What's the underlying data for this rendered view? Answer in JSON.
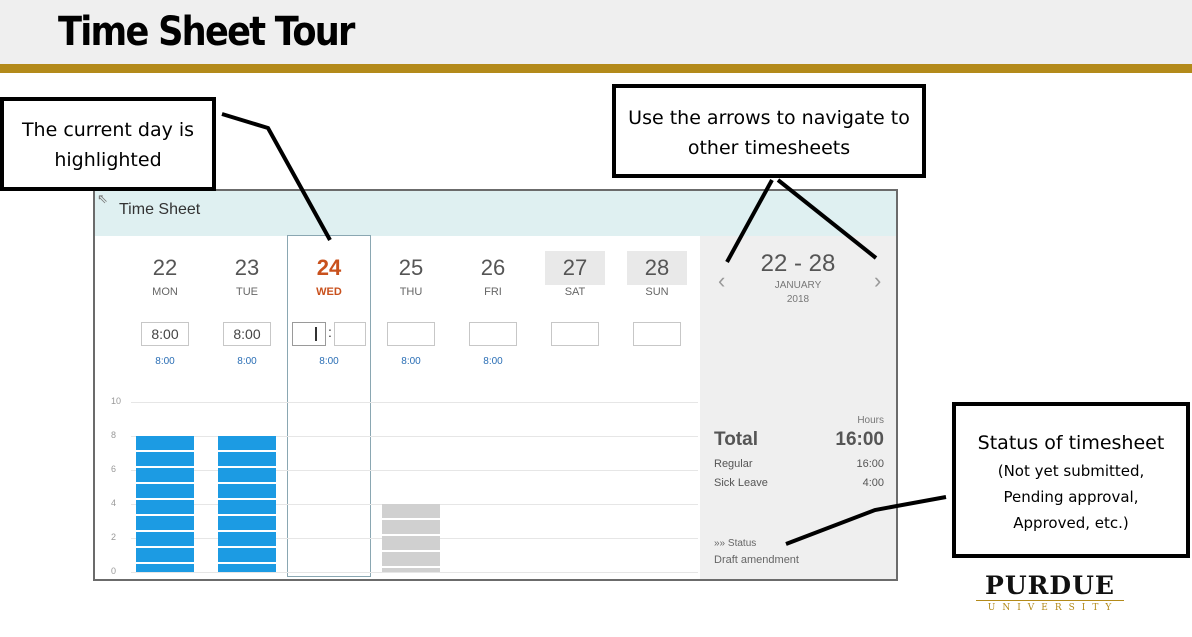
{
  "slide": {
    "title": "Time Sheet Tour"
  },
  "timesheet": {
    "title": "Time Sheet",
    "days": [
      {
        "num": "22",
        "name": "MON",
        "entry": "8:00",
        "sub": "8:00"
      },
      {
        "num": "23",
        "name": "TUE",
        "entry": "8:00",
        "sub": "8:00"
      },
      {
        "num": "24",
        "name": "WED",
        "entry": "",
        "sub": "8:00"
      },
      {
        "num": "25",
        "name": "THU",
        "entry": "",
        "sub": "8:00"
      },
      {
        "num": "26",
        "name": "FRI",
        "entry": "",
        "sub": "8:00"
      },
      {
        "num": "27",
        "name": "SAT",
        "entry": "",
        "sub": ""
      },
      {
        "num": "28",
        "name": "SUN",
        "entry": "",
        "sub": ""
      }
    ],
    "today_index": 2,
    "time_separator": ":",
    "chart": {
      "y_ticks": [
        "10",
        "8",
        "6",
        "4",
        "2",
        "0"
      ],
      "hours_by_day": [
        8,
        8,
        0,
        4,
        0,
        0,
        0
      ],
      "bar_colors": [
        "blue",
        "blue",
        "",
        "grey",
        "",
        "",
        ""
      ]
    },
    "summary": {
      "range": "22 - 28",
      "month": "JANUARY",
      "year": "2018",
      "prev_arrow": "‹",
      "next_arrow": "›",
      "hours_label": "Hours",
      "total_label": "Total",
      "total_value": "16:00",
      "rows": [
        {
          "label": "Regular",
          "value": "16:00"
        },
        {
          "label": "Sick Leave",
          "value": "4:00"
        }
      ],
      "status_label": "Status",
      "status_icon": "»»",
      "status_value": "Draft amendment"
    }
  },
  "callouts": {
    "current_day": "The current day is highlighted",
    "arrows": "Use the arrows to navigate to other timesheets",
    "status_title": "Status of timesheet",
    "status_body": "(Not yet submitted,\nPending approval,\nApproved, etc.)"
  },
  "logo": {
    "name": "PURDUE",
    "sub": "UNIVERSITY"
  },
  "colors": {
    "gold": "#b38a1a",
    "today": "#c9511d",
    "bar_blue": "#1c9be3",
    "bar_grey": "#d0d0d0",
    "header_teal": "#dff0f1"
  }
}
